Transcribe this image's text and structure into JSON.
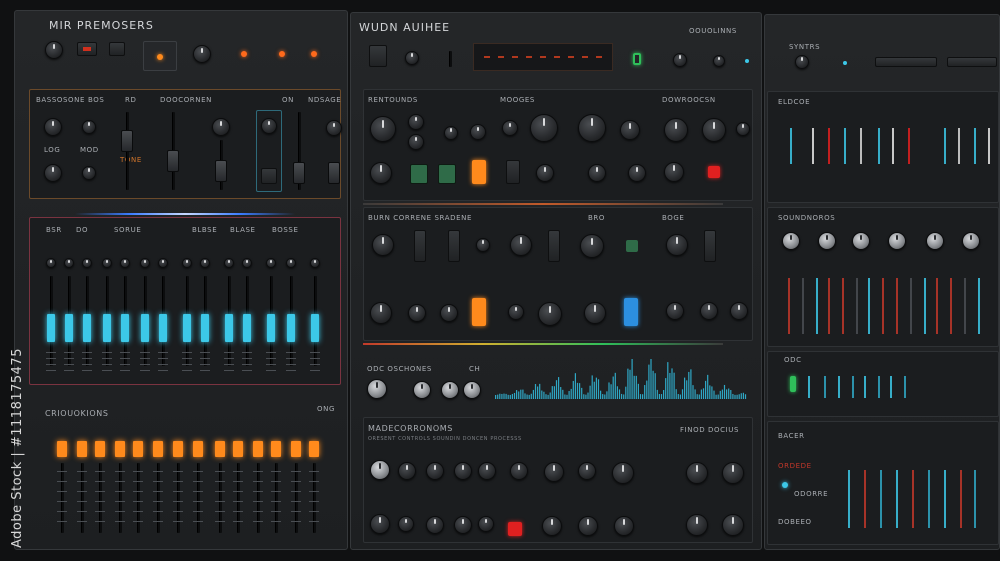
{
  "panels": {
    "left": {
      "title": "MIR PREMOSERS",
      "section_labels": [
        "BASSOSONE",
        "BOS",
        "RD",
        "DOOCORNEN",
        "ON",
        "NDSAGE"
      ],
      "section_sub": [
        "LOG",
        "MOD",
        "TONE"
      ],
      "bank_labels": [
        "BSR",
        "DO",
        "SORUE",
        "BLBSE",
        "BLASE",
        "BOSSE"
      ],
      "bottom_title": "CRIOUOKIONS",
      "bottom_tag": "ONG"
    },
    "middle": {
      "title": "WUDN AUIHEE",
      "top_tag": "OOUOLINNS",
      "section_labels": [
        "RENTOUNDS",
        "MOOGES",
        "DOWROOCSN"
      ],
      "mid_labels": [
        "BURN CORRENE SRADENE",
        "BRO",
        "BOGE"
      ],
      "wave_label": "ODC OSCHONES",
      "wave_tag": "CH",
      "bottom_title": "MADECORRONOMS",
      "bottom_right_title": "FINOD DOCIUS",
      "bottom_sub": "ORESENT CONTROLS SOUNDIN DONCEN PROCESSS"
    },
    "right": {
      "tag": "SYNTRS",
      "section_labels": [
        "ELDCOE",
        "SOUNDNOROS",
        "ODC",
        "BACER"
      ],
      "footer_labels": [
        "ORDEDE",
        "ODORRE",
        "DOBEEO"
      ]
    }
  },
  "watermark": "Adobe Stock | #1118175475",
  "colors": {
    "accent_orange": "#ff8a1c",
    "accent_cyan": "#3cc8e8",
    "accent_red": "#e02020",
    "accent_green": "#2fbf5a",
    "panel_bg": "#1f2123"
  }
}
